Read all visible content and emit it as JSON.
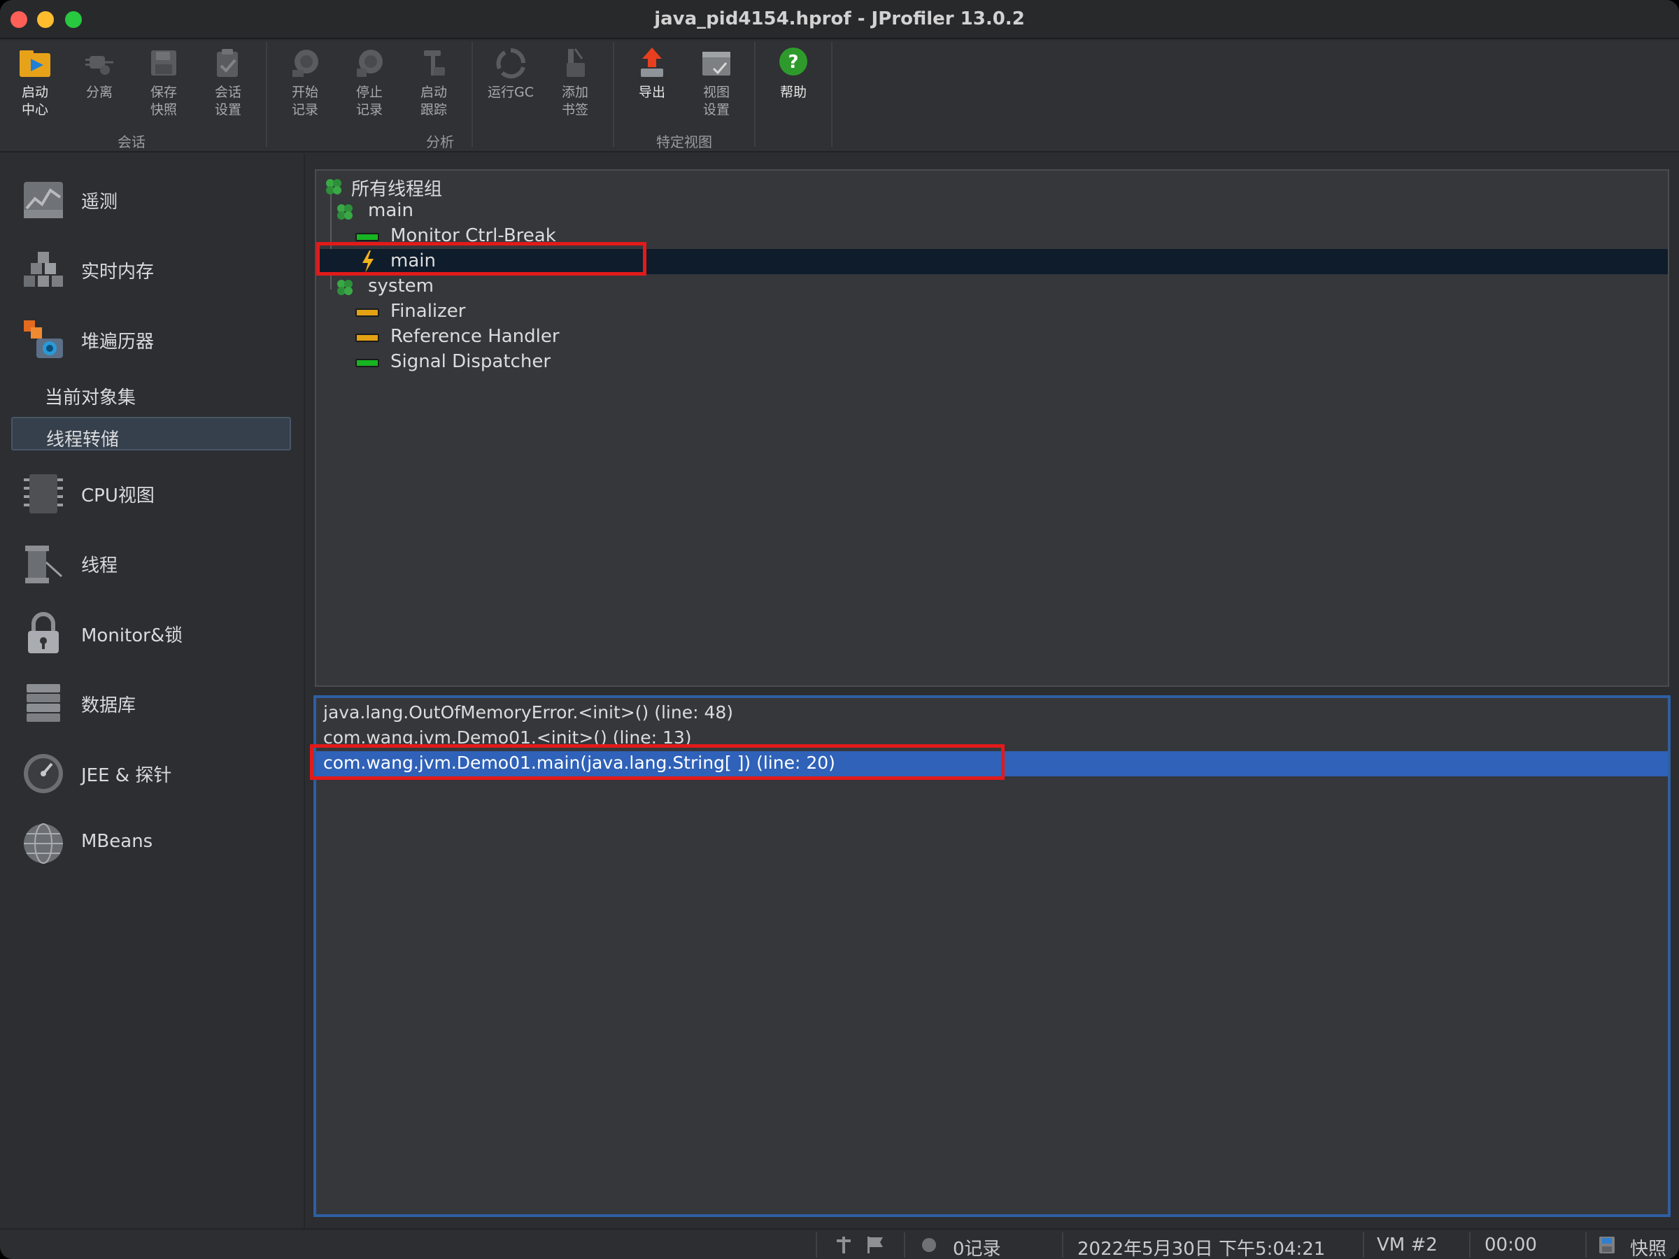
{
  "window": {
    "title": "java_pid4154.hprof - JProfiler 13.0.2"
  },
  "toolbar": {
    "buttons": [
      {
        "label": "启动\n中心",
        "icon": "launch-center-icon"
      },
      {
        "label": "分离",
        "icon": "detach-plug-icon"
      },
      {
        "label": "保存\n快照",
        "icon": "save-snapshot-icon"
      },
      {
        "label": "会话\n设置",
        "icon": "session-settings-icon"
      },
      {
        "label": "开始\n记录",
        "icon": "start-recording-icon"
      },
      {
        "label": "停止\n记录",
        "icon": "stop-recording-icon"
      },
      {
        "label": "启动\n跟踪",
        "icon": "start-tracking-icon"
      },
      {
        "label": "运行GC",
        "icon": "run-gc-icon"
      },
      {
        "label": "添加\n书签",
        "icon": "add-bookmark-icon"
      },
      {
        "label": "导出",
        "icon": "export-icon"
      },
      {
        "label": "视图\n设置",
        "icon": "view-settings-icon"
      },
      {
        "label": "帮助",
        "icon": "help-icon"
      }
    ],
    "groups": [
      "会话",
      "分析",
      "特定视图"
    ]
  },
  "sidebar": {
    "items": [
      {
        "label": "遥测",
        "icon": "telemetry-icon"
      },
      {
        "label": "实时内存",
        "icon": "live-memory-icon"
      },
      {
        "label": "堆遍历器",
        "icon": "heap-walker-icon"
      },
      {
        "label": "当前对象集",
        "icon": ""
      },
      {
        "label": "线程转储",
        "icon": ""
      },
      {
        "label": "CPU视图",
        "icon": "cpu-chip-icon"
      },
      {
        "label": "线程",
        "icon": "threads-icon"
      },
      {
        "label": "Monitor&锁",
        "icon": "lock-icon"
      },
      {
        "label": "数据库",
        "icon": "database-icon"
      },
      {
        "label": "JEE & 探针",
        "icon": "gauge-icon"
      },
      {
        "label": "MBeans",
        "icon": "globe-icon"
      }
    ],
    "selected": "线程转储"
  },
  "thread_tree": {
    "rows": [
      {
        "label": "所有线程组",
        "type": "group"
      },
      {
        "label": "main",
        "type": "group"
      },
      {
        "label": "Monitor Ctrl-Break",
        "type": "thread",
        "state": "runnable"
      },
      {
        "label": "main",
        "type": "thread",
        "state": "current"
      },
      {
        "label": "system",
        "type": "group"
      },
      {
        "label": "Finalizer",
        "type": "thread",
        "state": "waiting"
      },
      {
        "label": "Reference Handler",
        "type": "thread",
        "state": "waiting"
      },
      {
        "label": "Signal Dispatcher",
        "type": "thread",
        "state": "runnable"
      }
    ],
    "selected_index": 3
  },
  "stack_trace": {
    "frames": [
      "java.lang.OutOfMemoryError.<init>() (line: 48)",
      "com.wang.jvm.Demo01.<init>() (line: 13)",
      "com.wang.jvm.Demo01.main(java.lang.String[ ]) (line: 20)"
    ],
    "selected_index": 2
  },
  "statusbar": {
    "recordings": "0记录",
    "datetime": "2022年5月30日 下午5:04:21",
    "vm": "VM #2",
    "elapsed": "00:00",
    "mode": "快照"
  },
  "colors": {
    "highlight_box": "#e21a1a",
    "selection_blue": "#2f62b8",
    "tree_selection": "#0f1c2c",
    "thread_runnable": "#17b321",
    "thread_waiting": "#e3a114"
  }
}
